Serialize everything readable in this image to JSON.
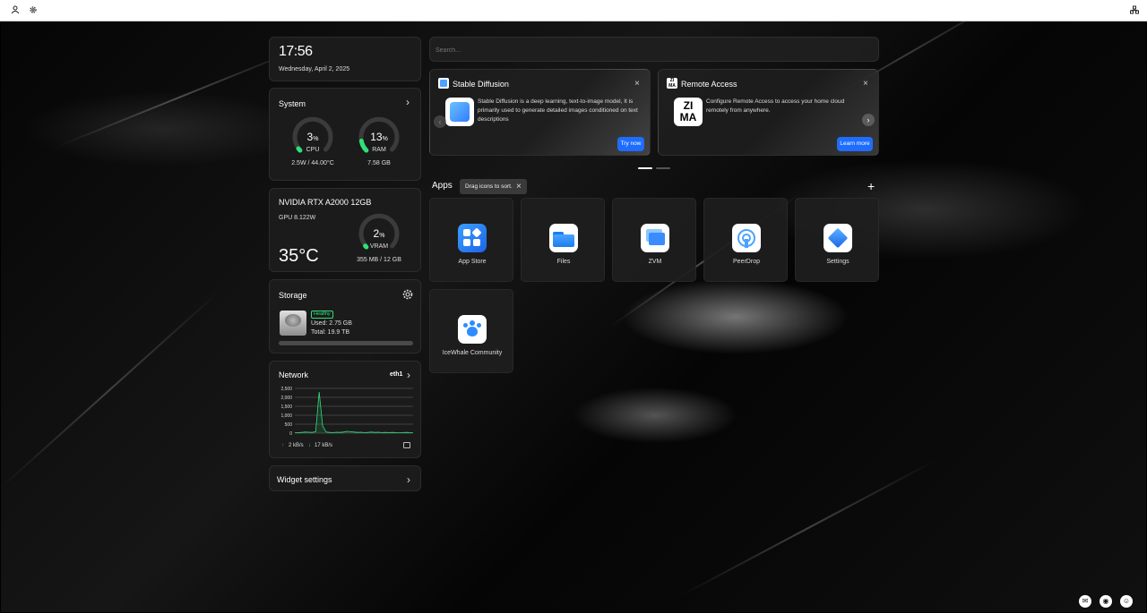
{
  "topbar": {
    "left_icons": [
      "user-icon",
      "gear-icon"
    ],
    "right_icon": "network-icon"
  },
  "clock": {
    "time": "17:56",
    "date": "Wednesday, April 2, 2025"
  },
  "system": {
    "title": "System",
    "cpu": {
      "value": "3",
      "unit": "%",
      "label": "CPU",
      "detail": "2.5W / 44.00°C",
      "fraction": 0.03
    },
    "ram": {
      "value": "13",
      "unit": "%",
      "label": "RAM",
      "detail": "7.58 GB",
      "fraction": 0.13
    }
  },
  "gpu": {
    "name": "NVIDIA RTX A2000 12GB",
    "power": "GPU 8.122W",
    "temp": "35°C",
    "vram": {
      "value": "2",
      "unit": "%",
      "label": "VRAM",
      "detail": "355 MB / 12 GB",
      "fraction": 0.02
    }
  },
  "storage": {
    "title": "Storage",
    "badge": "Healthy",
    "used": "Used: 2.75 GB",
    "total": "Total: 19.9 TB",
    "fraction": 0.0002
  },
  "network": {
    "title": "Network",
    "interface": "eth1",
    "upload": "2 kB/s",
    "download": "17 kB/s"
  },
  "chart_data": {
    "type": "line",
    "title": "",
    "xlabel": "",
    "ylabel": "",
    "ylim": [
      0,
      2500
    ],
    "yticks": [
      "2,500",
      "2,000",
      "1,500",
      "1,000",
      "500",
      "0"
    ],
    "ytick_values": [
      2500,
      2000,
      1500,
      1000,
      500,
      0
    ],
    "series": [
      {
        "values": [
          20,
          30,
          40,
          60,
          50,
          40,
          80,
          2300,
          400,
          60,
          40,
          30,
          50,
          40,
          60,
          100,
          80,
          60,
          40,
          50,
          30,
          40,
          60,
          40,
          50,
          30,
          40,
          30,
          40,
          30,
          20,
          30,
          40,
          30,
          20
        ]
      }
    ]
  },
  "widget_settings": {
    "label": "Widget settings"
  },
  "search": {
    "placeholder": "Search..."
  },
  "banners": [
    {
      "title": "Stable Diffusion",
      "body": "Stable Diffusion is a deep learning, text-to-image model, It is primarily used to generate detailed images conditioned on text descriptions",
      "button": "Try now"
    },
    {
      "title": "Remote Access",
      "body": "Configure Remote Access to access your home cloud remotely from anywhere.",
      "button": "Learn more"
    }
  ],
  "apps_section": {
    "title": "Apps",
    "tooltip": "Drag icons to sort.",
    "items": [
      {
        "name": "App Store",
        "icon": "app-store-icon"
      },
      {
        "name": "Files",
        "icon": "folder-icon"
      },
      {
        "name": "ZVM",
        "icon": "zvm-icon"
      },
      {
        "name": "PeerDrop",
        "icon": "peerdrop-icon"
      },
      {
        "name": "Settings",
        "icon": "settings-icon"
      },
      {
        "name": "IceWhale Community",
        "icon": "community-icon"
      }
    ]
  },
  "bottom_right_icons": [
    "mail-icon",
    "eye-icon",
    "account-icon"
  ]
}
